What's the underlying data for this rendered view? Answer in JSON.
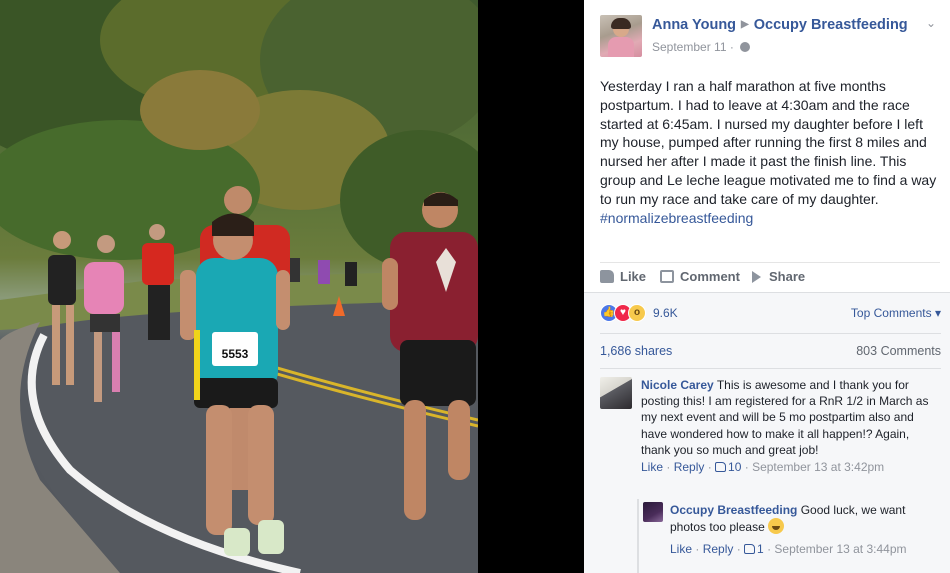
{
  "post": {
    "author": "Anna Young",
    "group": "Occupy Breastfeeding",
    "date": "September 11",
    "date_separator": "·",
    "text_main": "Yesterday I ran a half marathon at five months postpartum. I had to leave at 4:30am and the race started at 6:45am. I nursed my daughter before I left my house, pumped after running the first 8 miles and nursed her after I made it past the finish line. This group and Le leche league motivated me to find a way to run my race and take care of my daughter. ",
    "hashtag": "#normalizebreastfeeding"
  },
  "actions": {
    "like": "Like",
    "comment": "Comment",
    "share": "Share"
  },
  "stats": {
    "reaction_count": "9.6K",
    "top_comments": "Top Comments",
    "shares": "1,686 shares",
    "comments": "803 Comments"
  },
  "comments": [
    {
      "name": "Nicole Carey",
      "text": "This is awesome and I thank you for posting this! I am registered for a RnR 1/2 in March as my next event and will be 5 mo postpartim also and have wondered how to make it all happen!? Again, thank you so much and great job!",
      "like": "Like",
      "reply": "Reply",
      "likes": "10",
      "time": "September 13 at 3:42pm"
    },
    {
      "name": "Occupy Breastfeeding",
      "text": "Good luck, we want photos too please",
      "like": "Like",
      "reply": "Reply",
      "likes": "1",
      "time": "September 13 at 3:44pm"
    }
  ],
  "photo": {
    "bib_number": "5553"
  },
  "colors": {
    "link": "#365899",
    "muted": "#90949c",
    "text": "#1d2129"
  }
}
